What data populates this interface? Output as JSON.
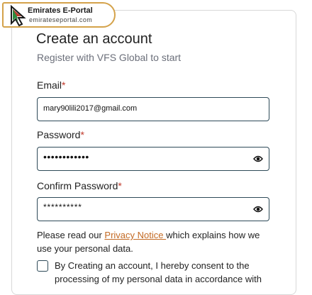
{
  "logo": {
    "title": "Emirates E-Portal",
    "subtitle": "emirateseportal.com",
    "icon": "cursor-arrow-logo"
  },
  "form": {
    "title": "Create an account",
    "subtitle": "Register with VFS Global to start",
    "required_mark": "*",
    "email": {
      "label": "Email",
      "value": "mary90lili2017@gmail.com"
    },
    "password": {
      "label": "Password",
      "value": "••••••••••••",
      "icon": "eye-icon"
    },
    "confirm_password": {
      "label": "Confirm Password",
      "value": "**********",
      "icon": "eye-icon"
    },
    "notice": {
      "before": "Please read our ",
      "link": "Privacy Notice ",
      "after": "which explains how we use your personal data."
    },
    "consent": {
      "checked": false,
      "text": "By Creating an account, I hereby consent to the processing of my personal data in accordance with"
    }
  },
  "colors": {
    "field_border": "#2e4a58",
    "link": "#c36a24",
    "required": "#c0392b",
    "subtitle": "#6b6f7a",
    "logo_border": "#d4a24a"
  }
}
